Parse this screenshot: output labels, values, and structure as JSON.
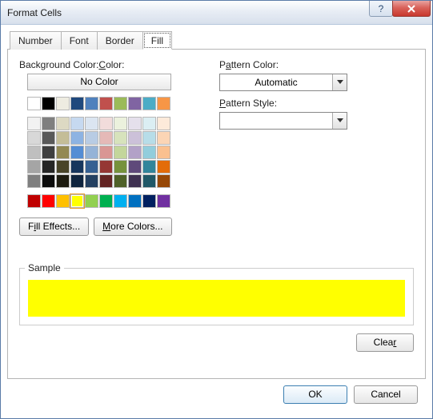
{
  "window": {
    "title": "Format Cells"
  },
  "tabs": [
    "Number",
    "Font",
    "Border",
    "Fill"
  ],
  "active_tab": "Fill",
  "labels": {
    "bg_color": "Background Color:",
    "no_color": "No Color",
    "fill_effects": "Fill Effects...",
    "more_colors": "More Colors...",
    "pattern_color": "Pattern Color:",
    "automatic": "Automatic",
    "pattern_style": "Pattern Style:",
    "sample": "Sample",
    "clear": "Clear",
    "ok": "OK",
    "cancel": "Cancel"
  },
  "selected_color": "#ffff00",
  "theme_colors_top": [
    "#ffffff",
    "#000000",
    "#eeece1",
    "#1f497d",
    "#4f81bd",
    "#c0504d",
    "#9bbb59",
    "#8064a2",
    "#4bacc6",
    "#f79646"
  ],
  "theme_tints": [
    [
      "#f2f2f2",
      "#7f7f7f",
      "#ddd9c3",
      "#c6d9f0",
      "#dbe5f1",
      "#f2dcdb",
      "#ebf1dd",
      "#e5e0ec",
      "#dbeef3",
      "#fdeada"
    ],
    [
      "#d8d8d8",
      "#595959",
      "#c4bd97",
      "#8db3e2",
      "#b8cce4",
      "#e5b9b7",
      "#d7e3bc",
      "#ccc1d9",
      "#b7dde8",
      "#fbd5b5"
    ],
    [
      "#bfbfbf",
      "#3f3f3f",
      "#938953",
      "#548dd4",
      "#95b3d7",
      "#d99694",
      "#c3d69b",
      "#b2a1c7",
      "#92cddc",
      "#fac08f"
    ],
    [
      "#a5a5a5",
      "#262626",
      "#494429",
      "#17365d",
      "#366092",
      "#953734",
      "#76923c",
      "#5f497a",
      "#31859b",
      "#e36c09"
    ],
    [
      "#7f7f7f",
      "#0c0c0c",
      "#1d1b10",
      "#0f243e",
      "#244061",
      "#632423",
      "#4f6128",
      "#3f3151",
      "#205867",
      "#974806"
    ]
  ],
  "standard_colors": [
    "#c00000",
    "#ff0000",
    "#ffc000",
    "#ffff00",
    "#92d050",
    "#00b050",
    "#00b0f0",
    "#0070c0",
    "#002060",
    "#7030a0"
  ],
  "chart_data": null
}
